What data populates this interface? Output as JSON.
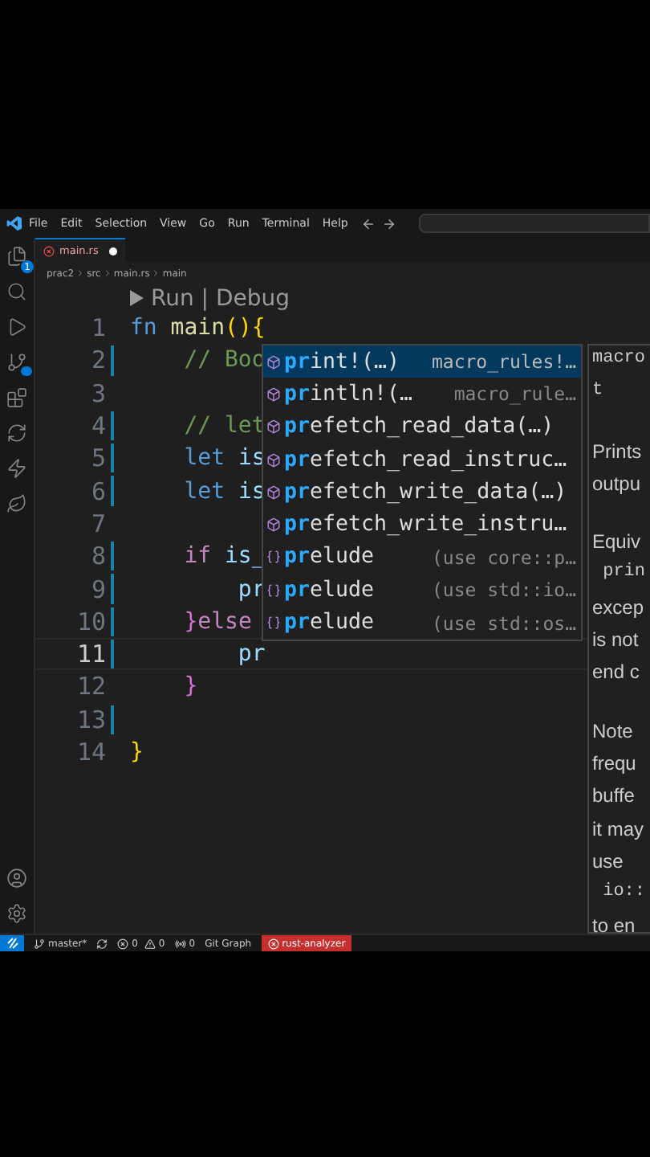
{
  "menu": [
    "File",
    "Edit",
    "Selection",
    "View",
    "Go",
    "Run",
    "Terminal",
    "Help"
  ],
  "activity_bar": {
    "top": [
      {
        "kind": "files",
        "badge": "1"
      },
      {
        "kind": "search"
      },
      {
        "kind": "run"
      },
      {
        "kind": "scm"
      },
      {
        "kind": "extensions"
      },
      {
        "kind": "edge"
      },
      {
        "kind": "bolt"
      },
      {
        "kind": "leaf"
      }
    ],
    "bottom": [
      {
        "kind": "account"
      },
      {
        "kind": "settings"
      }
    ]
  },
  "tabs": [
    {
      "label": "main.rs",
      "selected": true,
      "modified": true
    }
  ],
  "breadcrumb": [
    "prac2",
    "src",
    "main.rs",
    "main"
  ],
  "codelens": "Run | Debug",
  "lines": [
    {
      "number": "1",
      "changed": false,
      "current": false,
      "segments": [
        {
          "text": "fn",
          "kind": "keyword"
        },
        {
          "text": " main",
          "kind": "function"
        },
        {
          "text": "(){",
          "kind": "brace"
        }
      ]
    },
    {
      "number": "2",
      "changed": true,
      "current": false,
      "segments": [
        {
          "text": "    // Boo",
          "kind": "comment"
        }
      ]
    },
    {
      "number": "3",
      "changed": false,
      "current": false
    },
    {
      "number": "4",
      "changed": true,
      "current": false,
      "segments": [
        {
          "text": "    // let",
          "kind": "comment"
        }
      ]
    },
    {
      "number": "5",
      "changed": true,
      "current": false,
      "segments": [
        {
          "text": "    let",
          "kind": "keyword"
        },
        {
          "text": " is",
          "kind": "variable"
        }
      ]
    },
    {
      "number": "6",
      "changed": true,
      "current": false,
      "segments": [
        {
          "text": "    let",
          "kind": "keyword"
        },
        {
          "text": " is",
          "kind": "variable"
        }
      ]
    },
    {
      "number": "7",
      "changed": false,
      "current": false
    },
    {
      "number": "8",
      "changed": true,
      "current": false,
      "segments": [
        {
          "text": "    if",
          "kind": "control"
        },
        {
          "text": " is_",
          "kind": "variable"
        }
      ]
    },
    {
      "number": "9",
      "changed": true,
      "current": false,
      "segments": [
        {
          "text": "        pr",
          "kind": "variable"
        }
      ]
    },
    {
      "number": "10",
      "changed": true,
      "current": false,
      "segments": [
        {
          "text": "    }",
          "kind": "inner"
        },
        {
          "text": "else",
          "kind": "control"
        }
      ]
    },
    {
      "number": "11",
      "changed": true,
      "current": true,
      "segments": [
        {
          "text": "        pr",
          "kind": "variable"
        }
      ]
    },
    {
      "number": "12",
      "changed": false,
      "current": false,
      "segments": [
        {
          "text": "    }",
          "kind": "inner"
        }
      ]
    },
    {
      "number": "13",
      "changed": true,
      "current": false
    },
    {
      "number": "14",
      "changed": false,
      "current": false,
      "segments": [
        {
          "text": "}",
          "kind": "brace"
        }
      ]
    }
  ],
  "suggestions": [
    {
      "kind": "macro",
      "match": "pr",
      "rest": "int!(…)",
      "detail": "macro_rules!…",
      "selected": true
    },
    {
      "kind": "macro",
      "match": "pr",
      "rest": "intln!(…",
      "detail": "macro_rule…",
      "selected": false
    },
    {
      "kind": "macro",
      "match": "pr",
      "rest": "efetch_read_data(…)",
      "selected": false
    },
    {
      "kind": "macro",
      "match": "pr",
      "rest": "efetch_read_instruc…",
      "selected": false
    },
    {
      "kind": "macro",
      "match": "pr",
      "rest": "efetch_write_data(…)",
      "selected": false
    },
    {
      "kind": "macro",
      "match": "pr",
      "rest": "efetch_write_instru…",
      "selected": false
    },
    {
      "kind": "module",
      "match": "pr",
      "rest": "elude",
      "detail": "(use core::p…",
      "selected": false
    },
    {
      "kind": "module",
      "match": "pr",
      "rest": "elude",
      "detail": "(use std::io…",
      "selected": false
    },
    {
      "kind": "module",
      "match": "pr",
      "rest": "elude",
      "detail": "(use std::os…",
      "selected": false
    }
  ],
  "docs": [
    [
      {
        "text": "macro",
        "kind": "code"
      },
      {
        "text": "t",
        "kind": "code"
      }
    ],
    [
      {
        "text": "Prints",
        "kind": "text"
      },
      {
        "text": "outpu",
        "kind": "text"
      }
    ],
    [
      {
        "text": "Equiv",
        "kind": "text"
      },
      {
        "text": " prin",
        "kind": "code"
      },
      {
        "text": "excep",
        "kind": "text"
      },
      {
        "text": "is not",
        "kind": "text"
      },
      {
        "text": "end c",
        "kind": "text"
      }
    ],
    [
      {
        "text": "Note",
        "kind": "text"
      },
      {
        "text": "frequ",
        "kind": "text"
      },
      {
        "text": "buffe",
        "kind": "text"
      },
      {
        "text": "it may",
        "kind": "text"
      },
      {
        "text": "use",
        "kind": "text"
      },
      {
        "text": " io::",
        "kind": "code"
      },
      {
        "text": "to en",
        "kind": "text"
      }
    ]
  ],
  "status_bar": {
    "branch": "master*",
    "errors": "0",
    "warnings": "0",
    "ports": "0",
    "git_graph": "Git Graph",
    "server": "rust-analyzer"
  }
}
